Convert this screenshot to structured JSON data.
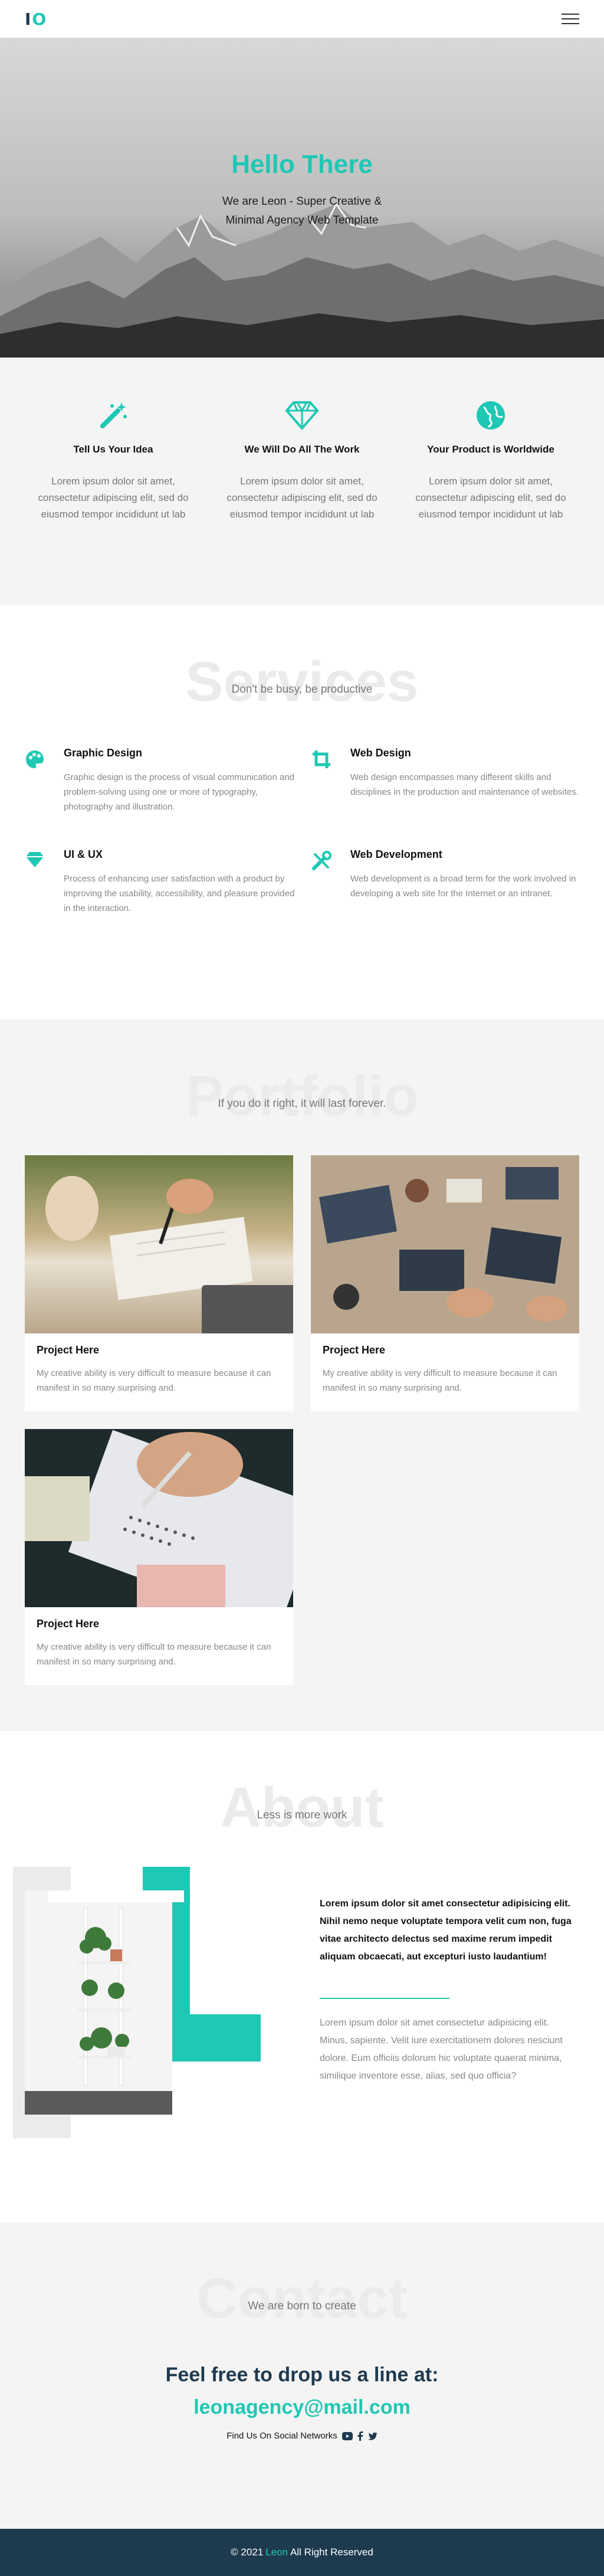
{
  "nav": {
    "logo_left": "I",
    "logo_right": "O"
  },
  "hero": {
    "title": "Hello There",
    "line1": "We are Leon - Super Creative &",
    "line2": "Minimal Agency Web Template"
  },
  "features": [
    {
      "icon": "magic-wand-icon",
      "title": "Tell Us Your Idea",
      "text": "Lorem ipsum dolor sit amet, consectetur adipiscing elit, sed do eiusmod tempor incididunt ut lab"
    },
    {
      "icon": "diamond-icon",
      "title": "We Will Do All The Work",
      "text": "Lorem ipsum dolor sit amet, consectetur adipiscing elit, sed do eiusmod tempor incididunt ut lab"
    },
    {
      "icon": "globe-icon",
      "title": "Your Product is Worldwide",
      "text": "Lorem ipsum dolor sit amet, consectetur adipiscing elit, sed do eiusmod tempor incididunt ut lab"
    }
  ],
  "services": {
    "big": "Services",
    "sub": "Don't be busy, be productive",
    "items": [
      {
        "icon": "palette-icon",
        "title": "Graphic Design",
        "text": "Graphic design is the process of visual communication and problem-solving using one or more of typography, photography and illustration."
      },
      {
        "icon": "crop-icon",
        "title": "Web Design",
        "text": "Web design encompasses many different skills and disciplines in the production and maintenance of websites."
      },
      {
        "icon": "gem-icon",
        "title": "UI & UX",
        "text": "Process of enhancing user satisfaction with a product by improving the usability, accessibility, and pleasure provided in the interaction."
      },
      {
        "icon": "tools-icon",
        "title": "Web Development",
        "text": "Web development is a broad term for the work involved in developing a web site for the Internet or an intranet."
      }
    ]
  },
  "portfolio": {
    "big": "Portfolio",
    "sub": "If you do it right, it will last forever.",
    "items": [
      {
        "title": "Project Here",
        "text": "My creative ability is very difficult to measure because it can manifest in so many surprising and."
      },
      {
        "title": "Project Here",
        "text": "My creative ability is very difficult to measure because it can manifest in so many surprising and."
      },
      {
        "title": "Project Here",
        "text": "My creative ability is very difficult to measure because it can manifest in so many surprising and."
      }
    ]
  },
  "about": {
    "big": "About",
    "sub": "Less is more work",
    "bold": "Lorem ipsum dolor sit amet consectetur adipisicing elit. Nihil nemo neque voluptate tempora velit cum non, fuga vitae architecto delectus sed maxime rerum impedit aliquam obcaecati, aut excepturi iusto laudantium!",
    "light": "Lorem ipsum dolor sit amet consectetur adipisicing elit. Minus, sapiente. Velit iure exercitationem dolores nesciunt dolore. Eum officiis dolorum hic voluptate quaerat minima, similique inventore esse, alias, sed quo officia?"
  },
  "contact": {
    "big": "Contact",
    "sub": "We are born to create",
    "heading": "Feel free to drop us a line at:",
    "email": "leonagency@mail.com",
    "social_label": "Find Us On Social Networks"
  },
  "footer": {
    "prefix": "© 2021",
    "brand": "Leon",
    "suffix": "All Right Reserved"
  },
  "colors": {
    "accent": "#1ec8b4",
    "navy": "#1e3a4f"
  }
}
